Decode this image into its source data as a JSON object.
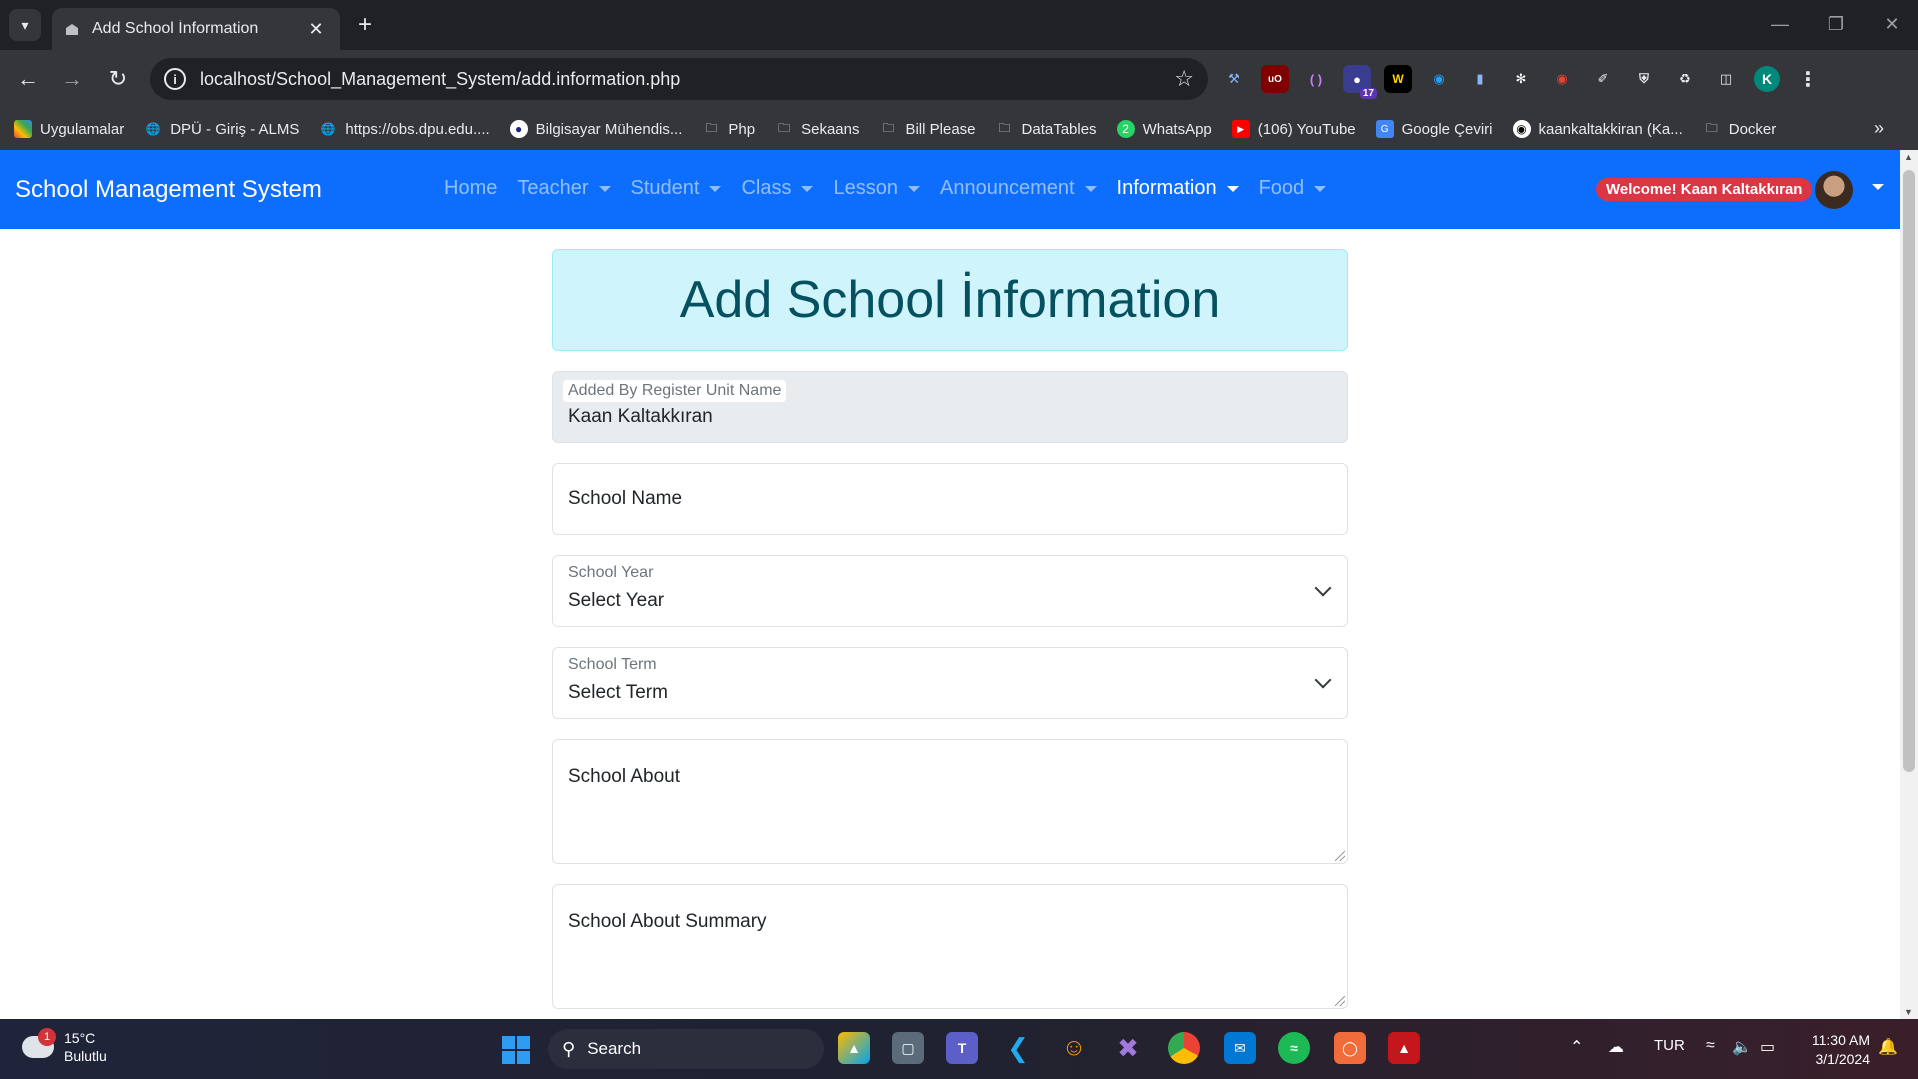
{
  "browser": {
    "tab_title": "Add School İnformation",
    "url": "localhost/School_Management_System/add.information.php",
    "profile_initial": "K",
    "extension_badge": "17",
    "bookmarks": [
      {
        "label": "Uygulamalar",
        "icon": "apps-grid-icon"
      },
      {
        "label": "DPÜ - Giriş - ALMS",
        "icon": "globe-icon"
      },
      {
        "label": "https://obs.dpu.edu....",
        "icon": "globe-icon"
      },
      {
        "label": "Bilgisayar Mühendis...",
        "icon": "university-icon"
      },
      {
        "label": "Php",
        "icon": "folder-icon"
      },
      {
        "label": "Sekaans",
        "icon": "folder-icon"
      },
      {
        "label": "Bill Please",
        "icon": "folder-icon"
      },
      {
        "label": "DataTables",
        "icon": "folder-icon"
      },
      {
        "label": "WhatsApp",
        "icon": "whatsapp-icon"
      },
      {
        "label": "(106) YouTube",
        "icon": "youtube-icon"
      },
      {
        "label": "Google Çeviri",
        "icon": "translate-icon"
      },
      {
        "label": "kaankaltakkiran (Ka...",
        "icon": "github-icon"
      },
      {
        "label": "Docker",
        "icon": "folder-icon"
      }
    ]
  },
  "navbar": {
    "brand": "School Management System",
    "items": [
      {
        "label": "Home",
        "dropdown": false,
        "active": false
      },
      {
        "label": "Teacher",
        "dropdown": true,
        "active": false
      },
      {
        "label": "Student",
        "dropdown": true,
        "active": false
      },
      {
        "label": "Class",
        "dropdown": true,
        "active": false
      },
      {
        "label": "Lesson",
        "dropdown": true,
        "active": false
      },
      {
        "label": "Announcement",
        "dropdown": true,
        "active": false
      },
      {
        "label": "Information",
        "dropdown": true,
        "active": true
      },
      {
        "label": "Food",
        "dropdown": true,
        "active": false
      }
    ],
    "welcome": "Welcome! Kaan Kaltakkıran"
  },
  "form": {
    "heading": "Add School İnformation",
    "added_by": {
      "label": "Added By Register Unit Name",
      "value": "Kaan Kaltakkıran"
    },
    "school_name": {
      "placeholder": "School Name"
    },
    "school_year": {
      "label": "School Year",
      "value": "Select Year"
    },
    "school_term": {
      "label": "School Term",
      "value": "Select Term"
    },
    "school_about": {
      "placeholder": "School About"
    },
    "school_about_summary": {
      "placeholder": "School About Summary"
    }
  },
  "taskbar": {
    "weather_temp": "15°C",
    "weather_desc": "Bulutlu",
    "weather_badge": "1",
    "search_label": "Search",
    "language": "TUR",
    "time": "11:30 AM",
    "date": "3/1/2024"
  },
  "colors": {
    "navbar_bg": "#0d6efd",
    "alert_bg": "#cff4fc",
    "alert_text": "#055160",
    "welcome_badge": "#dc3545"
  }
}
